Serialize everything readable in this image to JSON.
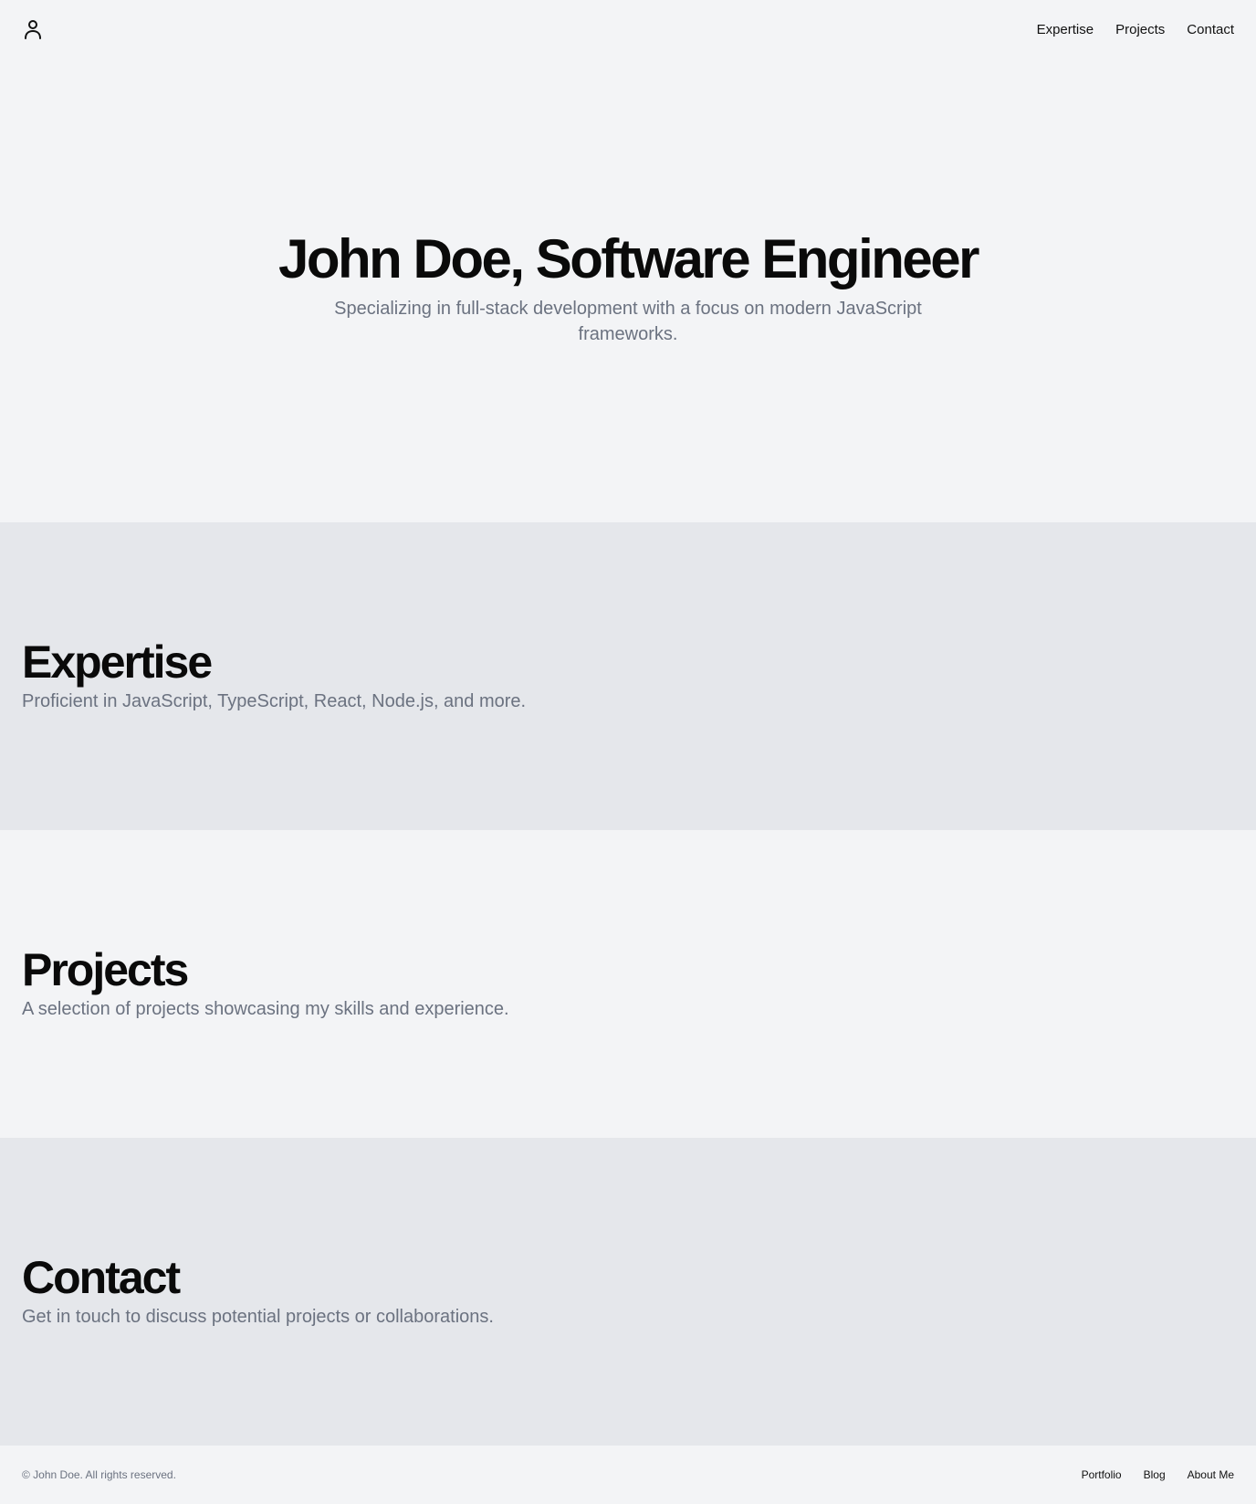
{
  "header": {
    "logo_icon": "user-icon",
    "nav": [
      {
        "label": "Expertise"
      },
      {
        "label": "Projects"
      },
      {
        "label": "Contact"
      }
    ]
  },
  "hero": {
    "title": "John Doe, Software Engineer",
    "subtitle": "Specializing in full-stack development with a focus on modern JavaScript frameworks."
  },
  "sections": [
    {
      "title": "Expertise",
      "text": "Proficient in JavaScript, TypeScript, React, Node.js, and more."
    },
    {
      "title": "Projects",
      "text": "A selection of projects showcasing my skills and experience."
    },
    {
      "title": "Contact",
      "text": "Get in touch to discuss potential projects or collaborations."
    }
  ],
  "footer": {
    "copyright": "© John Doe. All rights reserved.",
    "links": [
      {
        "label": "Portfolio"
      },
      {
        "label": "Blog"
      },
      {
        "label": "About Me"
      }
    ]
  },
  "colors": {
    "background": "#f3f4f6",
    "section_alt": "#e5e7eb",
    "text_primary": "#0a0a0a",
    "text_muted": "#6b7280"
  }
}
